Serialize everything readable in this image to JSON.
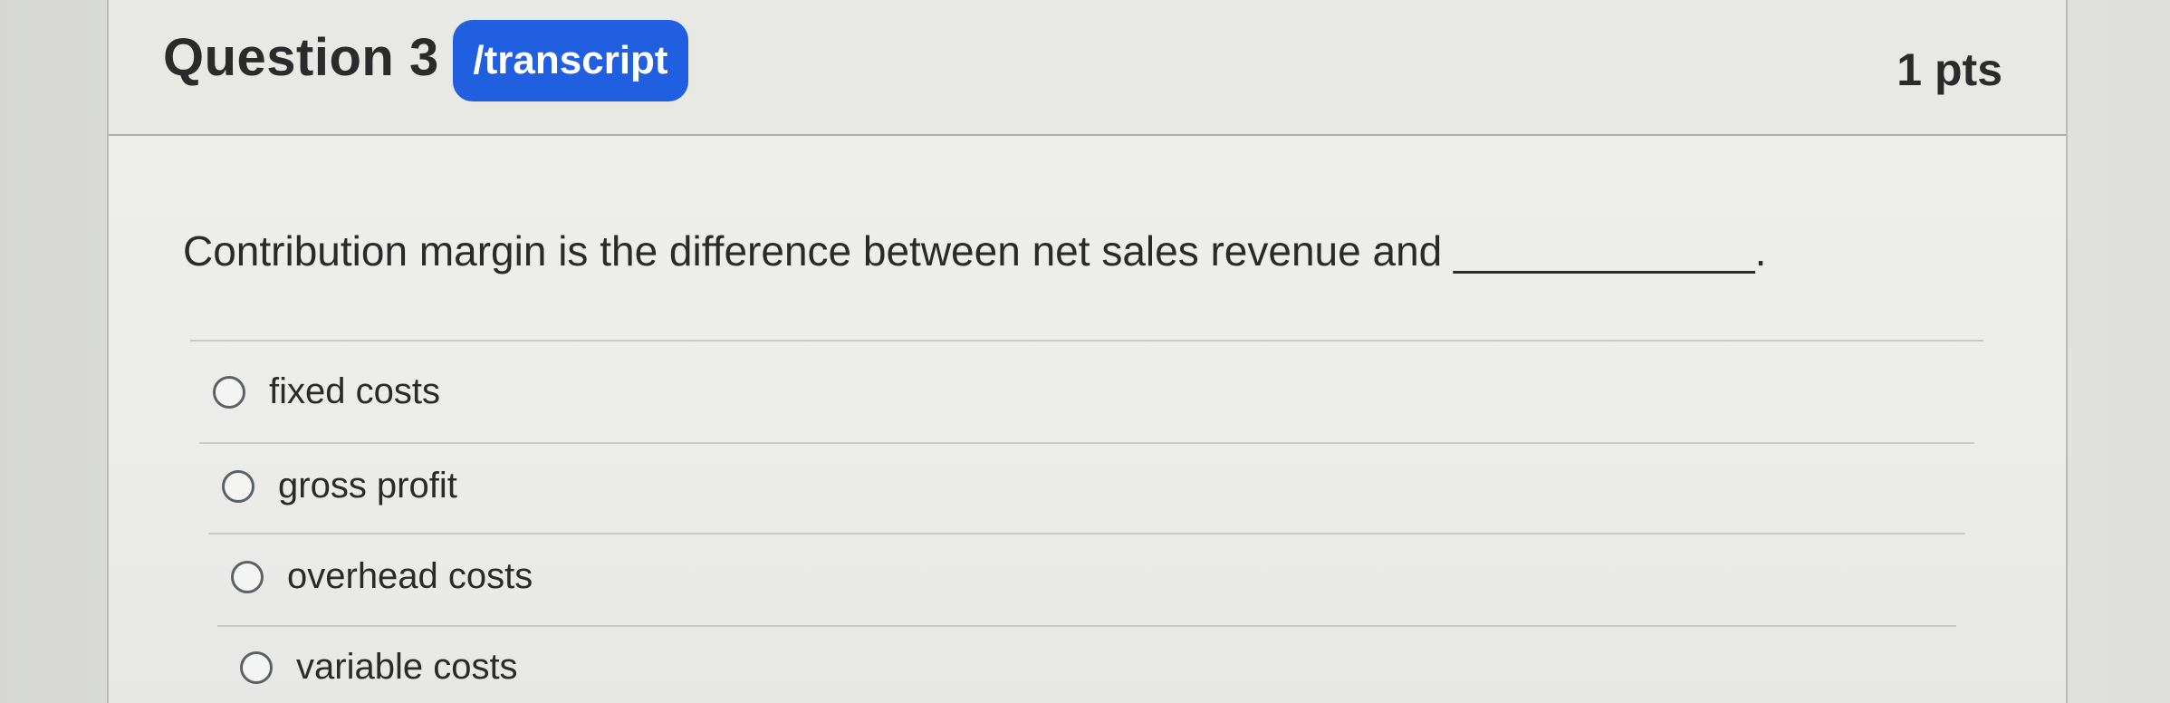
{
  "question": {
    "title": "Question 3",
    "badge": "/transcript",
    "points": "1 pts",
    "text": "Contribution margin is the difference between net sales revenue and _____________."
  },
  "answers": [
    {
      "label": "fixed costs"
    },
    {
      "label": "gross profit"
    },
    {
      "label": "overhead costs"
    },
    {
      "label": "variable costs"
    }
  ]
}
